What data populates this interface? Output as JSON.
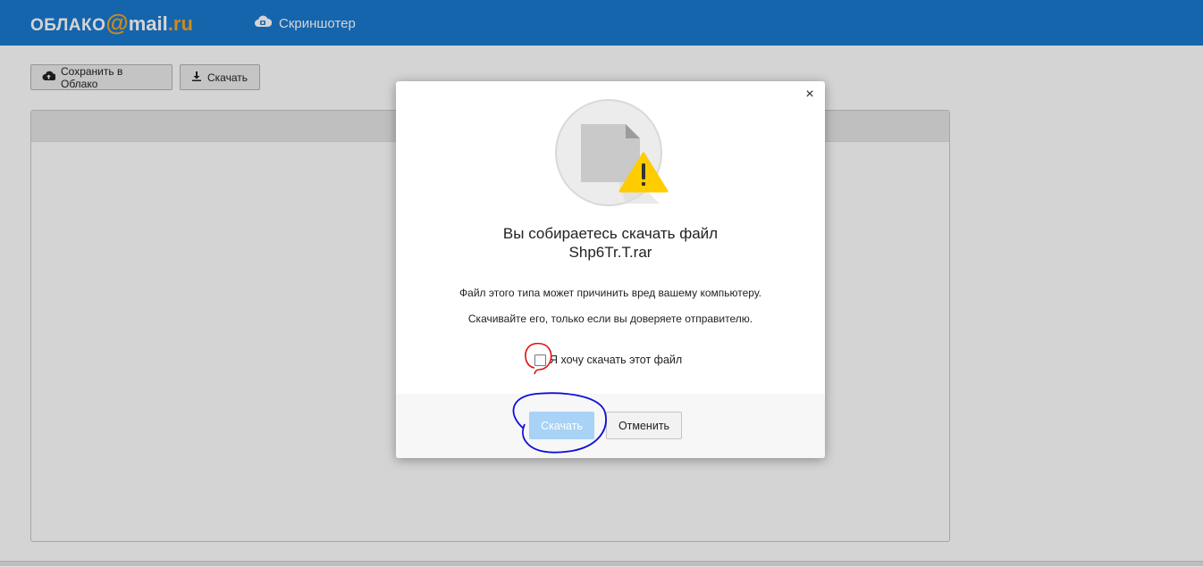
{
  "header": {
    "logo_part1": "ОБЛАКО",
    "logo_at": "@",
    "logo_part2": "mail",
    "logo_part3": ".ru",
    "app_label": "Скриншотер",
    "app_icon": "cloud-camera-icon"
  },
  "toolbar": {
    "save_label": "Сохранить в Облако",
    "save_icon": "cloud-upload-icon",
    "download_label": "Скачать",
    "download_icon": "download-icon"
  },
  "modal": {
    "close_label": "×",
    "title_line1": "Вы собираетесь скачать файл",
    "title_line2": "Shp6Tr.T.rar",
    "message1": "Файл этого типа может причинить вред вашему компьютеру.",
    "message2": "Скачивайте его, только если вы доверяете отправителю.",
    "checkbox_label": "Я хочу скачать этот файл",
    "checkbox_checked": false,
    "download_button": "Скачать",
    "cancel_button": "Отменить",
    "warning_icon": "warning-icon"
  },
  "colors": {
    "header_bg": "#1a7ad0",
    "logo_accent": "#f5a623",
    "primary_disabled": "#a8d2f6",
    "warning": "#ffcc00"
  }
}
